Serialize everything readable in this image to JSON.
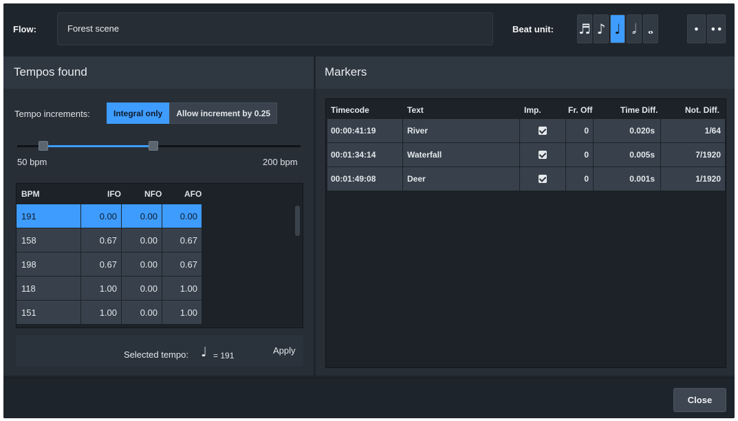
{
  "header": {
    "flow_label": "Flow:",
    "flow_value": "Forest scene",
    "beat_unit_label": "Beat unit:",
    "beat_units": [
      {
        "glyph": "♬",
        "icon": "sixteenth-note-icon",
        "active": false
      },
      {
        "glyph": "♪",
        "icon": "eighth-note-icon",
        "active": false
      },
      {
        "glyph": "♩",
        "icon": "quarter-note-icon",
        "active": true
      },
      {
        "glyph": "𝅗𝅥",
        "icon": "half-note-icon",
        "active": false
      },
      {
        "glyph": "𝅝",
        "icon": "whole-note-icon",
        "active": false
      }
    ],
    "dot_units": [
      {
        "glyph": "•",
        "icon": "single-dot-icon"
      },
      {
        "glyph": "••",
        "icon": "double-dot-icon"
      }
    ]
  },
  "tempos": {
    "title": "Tempos found",
    "increments_label": "Tempo increments:",
    "increment_options": [
      "Integral only",
      "Allow increment by 0.25"
    ],
    "selected_increment": "Integral only",
    "slider_min_label": "50 bpm",
    "slider_max_label": "200 bpm",
    "columns": [
      "BPM",
      "IFO",
      "NFO",
      "AFO"
    ],
    "rows": [
      {
        "bpm": "191",
        "ifo": "0.00",
        "nfo": "0.00",
        "afo": "0.00",
        "selected": true
      },
      {
        "bpm": "158",
        "ifo": "0.67",
        "nfo": "0.00",
        "afo": "0.67",
        "selected": false
      },
      {
        "bpm": "198",
        "ifo": "0.67",
        "nfo": "0.00",
        "afo": "0.67",
        "selected": false
      },
      {
        "bpm": "118",
        "ifo": "1.00",
        "nfo": "0.00",
        "afo": "1.00",
        "selected": false
      },
      {
        "bpm": "151",
        "ifo": "1.00",
        "nfo": "0.00",
        "afo": "1.00",
        "selected": false
      }
    ],
    "selected_tempo_label": "Selected tempo:",
    "selected_tempo_note": "♩",
    "selected_tempo_value": "= 191",
    "apply_label": "Apply"
  },
  "markers": {
    "title": "Markers",
    "columns": [
      "Timecode",
      "Text",
      "Imp.",
      "Fr. Off",
      "Time Diff.",
      "Not. Diff."
    ],
    "rows": [
      {
        "timecode": "00:00:41:19",
        "text": "River",
        "imp": true,
        "fr_off": "0",
        "time_diff": "0.020s",
        "not_diff": "1/64"
      },
      {
        "timecode": "00:01:34:14",
        "text": "Waterfall",
        "imp": true,
        "fr_off": "0",
        "time_diff": "0.005s",
        "not_diff": "7/1920"
      },
      {
        "timecode": "00:01:49:08",
        "text": "Deer",
        "imp": true,
        "fr_off": "0",
        "time_diff": "0.001s",
        "not_diff": "1/1920"
      }
    ]
  },
  "footer": {
    "close_label": "Close"
  }
}
